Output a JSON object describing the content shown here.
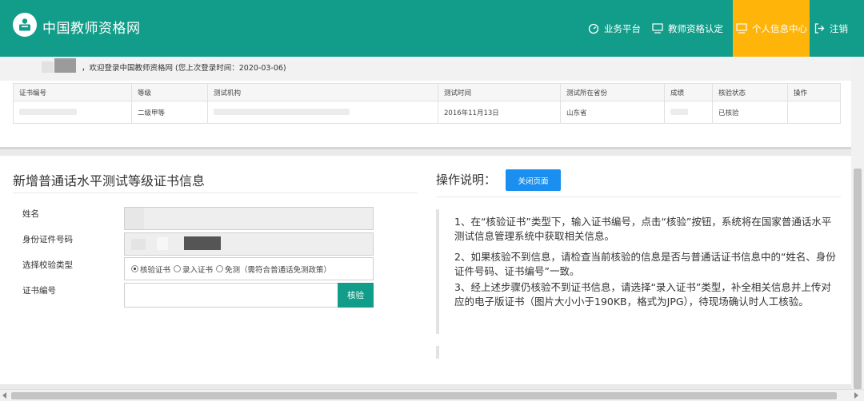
{
  "header": {
    "site_title": "中国教师资格网",
    "nav": [
      {
        "label": "业务平台",
        "icon": "dashboard-icon"
      },
      {
        "label": "教师资格认定",
        "icon": "monitor-icon"
      },
      {
        "label": "个人信息中心",
        "icon": "monitor-icon",
        "active": true
      },
      {
        "label": "注销",
        "icon": "logout-icon"
      }
    ],
    "accent_color": "#129d8a",
    "active_color": "#ffb40a"
  },
  "welcome": {
    "text": "，欢迎登录中国教师资格网 (您上次登录时间：2020-03-06)"
  },
  "cert_table": {
    "columns": [
      "证书编号",
      "等级",
      "测试机构",
      "测试时间",
      "测试所在省份",
      "成绩",
      "核验状态",
      "操作"
    ],
    "rows": [
      {
        "cert_no": "",
        "level": "二级甲等",
        "org": "",
        "date": "2016年11月13日",
        "province": "山东省",
        "score": "",
        "status": "已核验",
        "action": ""
      }
    ]
  },
  "form": {
    "title": "新增普通话水平测试等级证书信息",
    "name_label": "姓名",
    "id_label": "身份证件号码",
    "type_label": "选择校验类型",
    "cert_label": "证书编号",
    "radio_options": [
      "核验证书",
      "录入证书",
      "免测（需符合普通话免测政策）"
    ],
    "selected_radio": 0,
    "verify_button": "核验"
  },
  "help": {
    "title": "操作说明：",
    "close_button": "关闭页面",
    "paragraphs": [
      "1、在“核验证书”类型下，输入证书编号，点击“核验”按钮，系统将在国家普通话水平测试信息管理系统中获取相关信息。",
      "2、如果核验不到信息，请检查当前核验的信息是否与普通话证书信息中的“姓名、身份证件号码、证书编号”一致。",
      "3、经上述步骤仍核验不到证书信息，请选择“录入证书”类型，补全相关信息并上传对应的电子版证书（图片大小小于190KB，格式为JPG），待现场确认时人工核验。"
    ]
  }
}
